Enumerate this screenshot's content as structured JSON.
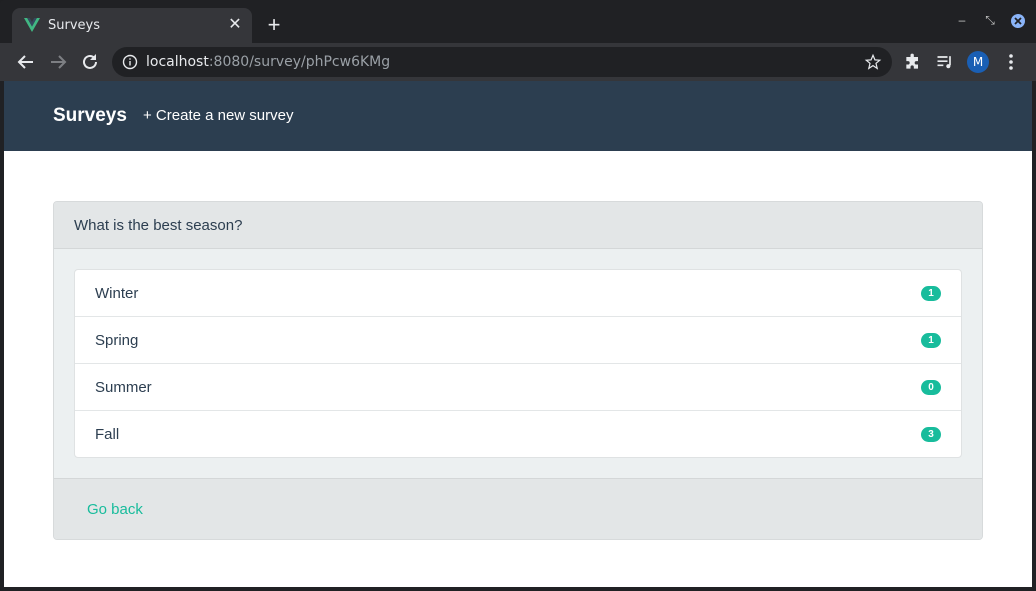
{
  "browser": {
    "tab_title": "Surveys",
    "url_host": "localhost",
    "url_rest": ":8080/survey/phPcw6KMg",
    "avatar_initial": "M"
  },
  "navbar": {
    "brand": "Surveys",
    "create_link": "+ Create a new survey"
  },
  "survey": {
    "question": "What is the best season?",
    "options": [
      {
        "label": "Winter",
        "votes": "1"
      },
      {
        "label": "Spring",
        "votes": "1"
      },
      {
        "label": "Summer",
        "votes": "0"
      },
      {
        "label": "Fall",
        "votes": "3"
      }
    ],
    "go_back": "Go back"
  },
  "colors": {
    "navbar": "#2c3e50",
    "accent": "#18bc9c"
  }
}
